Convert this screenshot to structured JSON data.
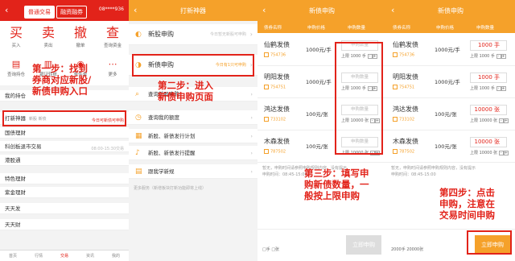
{
  "p1": {
    "tabs": [
      "普通交易",
      "融资融券"
    ],
    "account": "08****936",
    "grid": [
      {
        "big": "买",
        "sm": "买入"
      },
      {
        "big": "卖",
        "sm": "卖出"
      },
      {
        "big": "撤",
        "sm": "撤单"
      },
      {
        "big": "查",
        "sm": "查询资金"
      },
      {
        "ic": "▤",
        "sm": "查询持仓"
      },
      {
        "ic": "▥",
        "sm": "银证转账"
      },
      {
        "ic": "◉",
        "sm": "条件单"
      },
      {
        "ic": "⋯",
        "sm": "更多"
      }
    ],
    "mine": "我的持仓",
    "rows": [
      "打新神器",
      "国债理财",
      "科创板退市交易",
      "港股通",
      "特色理财",
      "紫金理财",
      "天天发",
      "天天财"
    ],
    "row_tag": "今日可新债可申购",
    "row0_sub": "新股 新债",
    "row2_sub": "08:00-15:30交易",
    "nav": [
      "首页",
      "行情",
      "交易",
      "资讯",
      "我的"
    ]
  },
  "p2": {
    "title": "打新神器",
    "top_label": "新股申购",
    "top_right": "今日暂无新股可申购",
    "second_label": "新债申购",
    "second_right": "今日有1只可申购",
    "items": [
      "查询新股申购",
      "查询我的额度",
      "新股、新债发行计划",
      "新股、新债发行提醒",
      "跟我学新规"
    ],
    "footnote": "更多服务（新增板块打新功能即将上线）"
  },
  "p3": {
    "title": "新债申购",
    "cols": [
      "债券名称",
      "申购价格",
      "申购数量"
    ],
    "bonds": [
      {
        "name": "仙鹤发债",
        "code": "754736",
        "price": "1000元/手",
        "ph": "申购数量",
        "lim": "上限 1000 手"
      },
      {
        "name": "明阳发债",
        "code": "754751",
        "price": "1000元/手",
        "ph": "申购数量",
        "lim": "上限 1000 手"
      },
      {
        "name": "鸿达发债",
        "code": "733102",
        "price": "100元/张",
        "ph": "申购数量",
        "lim": "上限 10000 张"
      },
      {
        "name": "木森发债",
        "code": "787502",
        "price": "100元/张",
        "ph": "申购数量",
        "lim": "上限 10000 张"
      }
    ],
    "tips": "暂无，申购时间请参照申购规则内容，没有提示",
    "time": "申购时间：08:45-15:00",
    "sel": "□手 □张",
    "btn": "立即申购"
  },
  "p4": {
    "title": "新债申购",
    "cols": [
      "债券名称",
      "申购价格",
      "申购数量"
    ],
    "bonds": [
      {
        "name": "仙鹤发债",
        "code": "754736",
        "price": "1000元/手",
        "val": "1000 手",
        "lim": "上限 1000 手"
      },
      {
        "name": "明阳发债",
        "code": "754751",
        "price": "1000元/手",
        "val": "1000 手",
        "lim": "上限 1000 手"
      },
      {
        "name": "鸿达发债",
        "code": "733102",
        "price": "100元/张",
        "val": "10000 张",
        "lim": "上限 10000 张"
      },
      {
        "name": "木森发债",
        "code": "787502",
        "price": "100元/张",
        "val": "10000 张",
        "lim": "上限 10000 张"
      }
    ],
    "tips": "暂无，申购时间请参照申购规则内容，没有提示",
    "time": "申购时间：08:45-15:00",
    "sel": "2000手 20000张",
    "btn": "立即申购"
  },
  "ann": {
    "s1": [
      "第一步：找到",
      "券商对应新股/",
      "新债申购入口"
    ],
    "s2": [
      "第二步：进入",
      "新债申购页面"
    ],
    "s3": [
      "第三步：填写申",
      "购新债数量，一",
      "般按上限申购"
    ],
    "s4": [
      "第四步：点击",
      "申购，注意在",
      "交易时间申购"
    ]
  }
}
